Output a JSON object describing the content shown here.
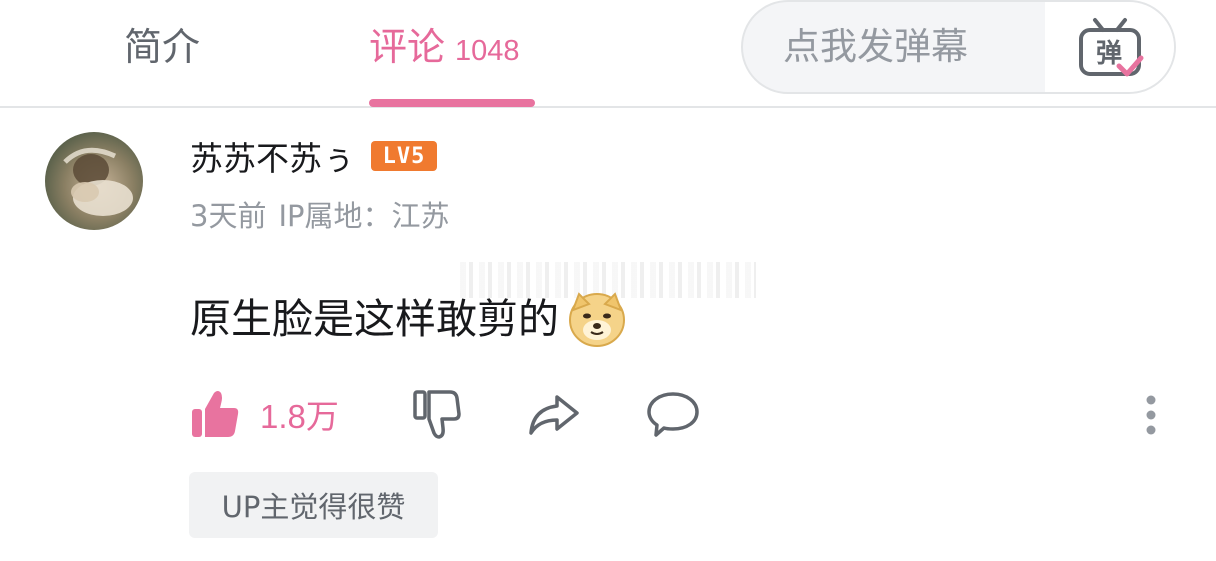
{
  "tabs": {
    "intro_label": "简介",
    "comments_label": "评论",
    "comments_count": "1048"
  },
  "danmaku": {
    "placeholder": "点我发弹幕",
    "toggle_label": "弹"
  },
  "colors": {
    "accent_pink": "#e6699a",
    "level_badge": "#f07a2f",
    "text_primary": "#18191c",
    "text_secondary": "#9499a0"
  },
  "comment": {
    "username": "苏苏不苏ぅ",
    "level": "LV5",
    "time": "3天前",
    "ip_location": "IP属地：江苏",
    "content": "原生脸是这样敢剪的",
    "emoji": "doge-emoji",
    "like_count": "1.8万",
    "up_badge": "UP主觉得很赞"
  },
  "icons": {
    "like": "thumbs-up-icon",
    "dislike": "thumbs-down-icon",
    "share": "share-icon",
    "reply": "speech-bubble-icon",
    "more": "more-vertical-icon"
  }
}
